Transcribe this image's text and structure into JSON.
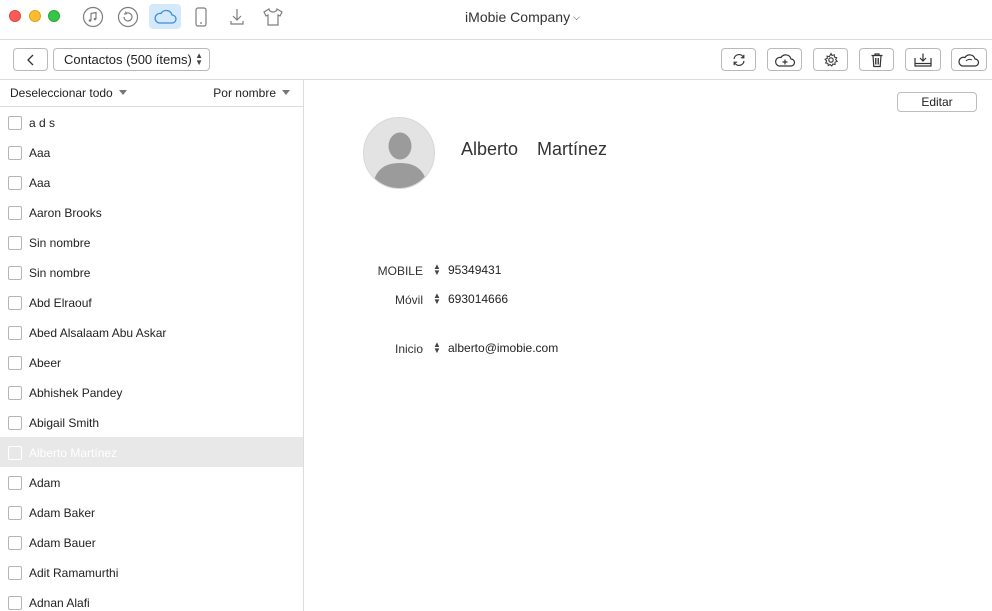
{
  "window": {
    "title": "iMobie Company"
  },
  "mode_icons": [
    "music-icon",
    "restore-icon",
    "icloud-icon",
    "phone-icon",
    "download-icon",
    "shirt-icon"
  ],
  "toolbar": {
    "selector_label": "Contactos (500 ítems)"
  },
  "toolbar_icons": [
    "refresh-icon",
    "cloud-add-icon",
    "gear-icon",
    "trash-icon",
    "to-device-icon",
    "cloud-sync-icon"
  ],
  "sidebar": {
    "deselect_label": "Deseleccionar todo",
    "sort_label": "Por nombre",
    "contacts": [
      "a d s",
      "Aaa",
      "Aaa",
      "Aaron Brooks",
      "Sin nombre",
      "Sin nombre",
      "Abd Elraouf",
      "Abed Alsalaam Abu Askar",
      "Abeer",
      "Abhishek Pandey",
      "Abigail Smith",
      "Alberto Martínez",
      "Adam",
      "Adam Baker",
      "Adam Bauer",
      "Adit Ramamurthi",
      "Adnan Alafi"
    ],
    "selected_index": 11
  },
  "detail": {
    "edit_label": "Editar",
    "first_name": "Alberto",
    "last_name": "Martínez",
    "fields": [
      {
        "label": "MOBILE",
        "value": "95349431"
      },
      {
        "label": "Móvil",
        "value": "693014666"
      },
      {
        "label": "Inicio",
        "value": "alberto@imobie.com"
      }
    ]
  },
  "colors": {
    "accent": "#3d8fe0",
    "active_tab_bg": "#d6e9fb",
    "selected_row": "#e8e8e8"
  }
}
